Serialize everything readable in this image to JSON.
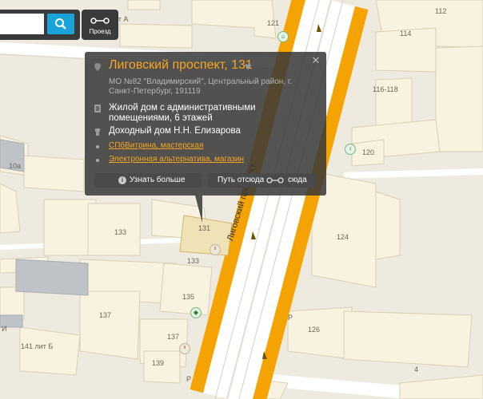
{
  "map": {
    "street_name": "Лиговский проспект",
    "house_labels": [
      {
        "text": "123 лит А",
        "pos": "top-left"
      },
      {
        "text": "121"
      },
      {
        "text": "112"
      },
      {
        "text": "114"
      },
      {
        "text": "116-118"
      },
      {
        "text": "120"
      },
      {
        "text": "10а"
      },
      {
        "text": "124"
      },
      {
        "text": "133"
      },
      {
        "text": "131"
      },
      {
        "text": "133"
      },
      {
        "text": "135"
      },
      {
        "text": "137"
      },
      {
        "text": "137"
      },
      {
        "text": "139"
      },
      {
        "text": "141 лит Б"
      },
      {
        "text": "126"
      },
      {
        "text": "4"
      },
      {
        "text": "Р"
      },
      {
        "text": "Р"
      },
      {
        "text": "И"
      }
    ]
  },
  "search": {
    "value": "",
    "route_label": "Проезд"
  },
  "popup": {
    "title": "Лиговский проспект, 131",
    "address": "МО №82 \"Владимирский\", Центральный район, г. Санкт-Петербург, 191119",
    "building_type": "Жилой дом с административными помещениями, 6 этажей",
    "historic_name": "Доходный дом Н.Н. Елизарова",
    "organizations": [
      "СПбВитрина, мастерская",
      "Электронная альтернатива, магазин"
    ],
    "more_button": "Узнать больше",
    "route_from": "Путь отсюда",
    "route_to": "сюда",
    "accent_color": "#f5a623"
  }
}
